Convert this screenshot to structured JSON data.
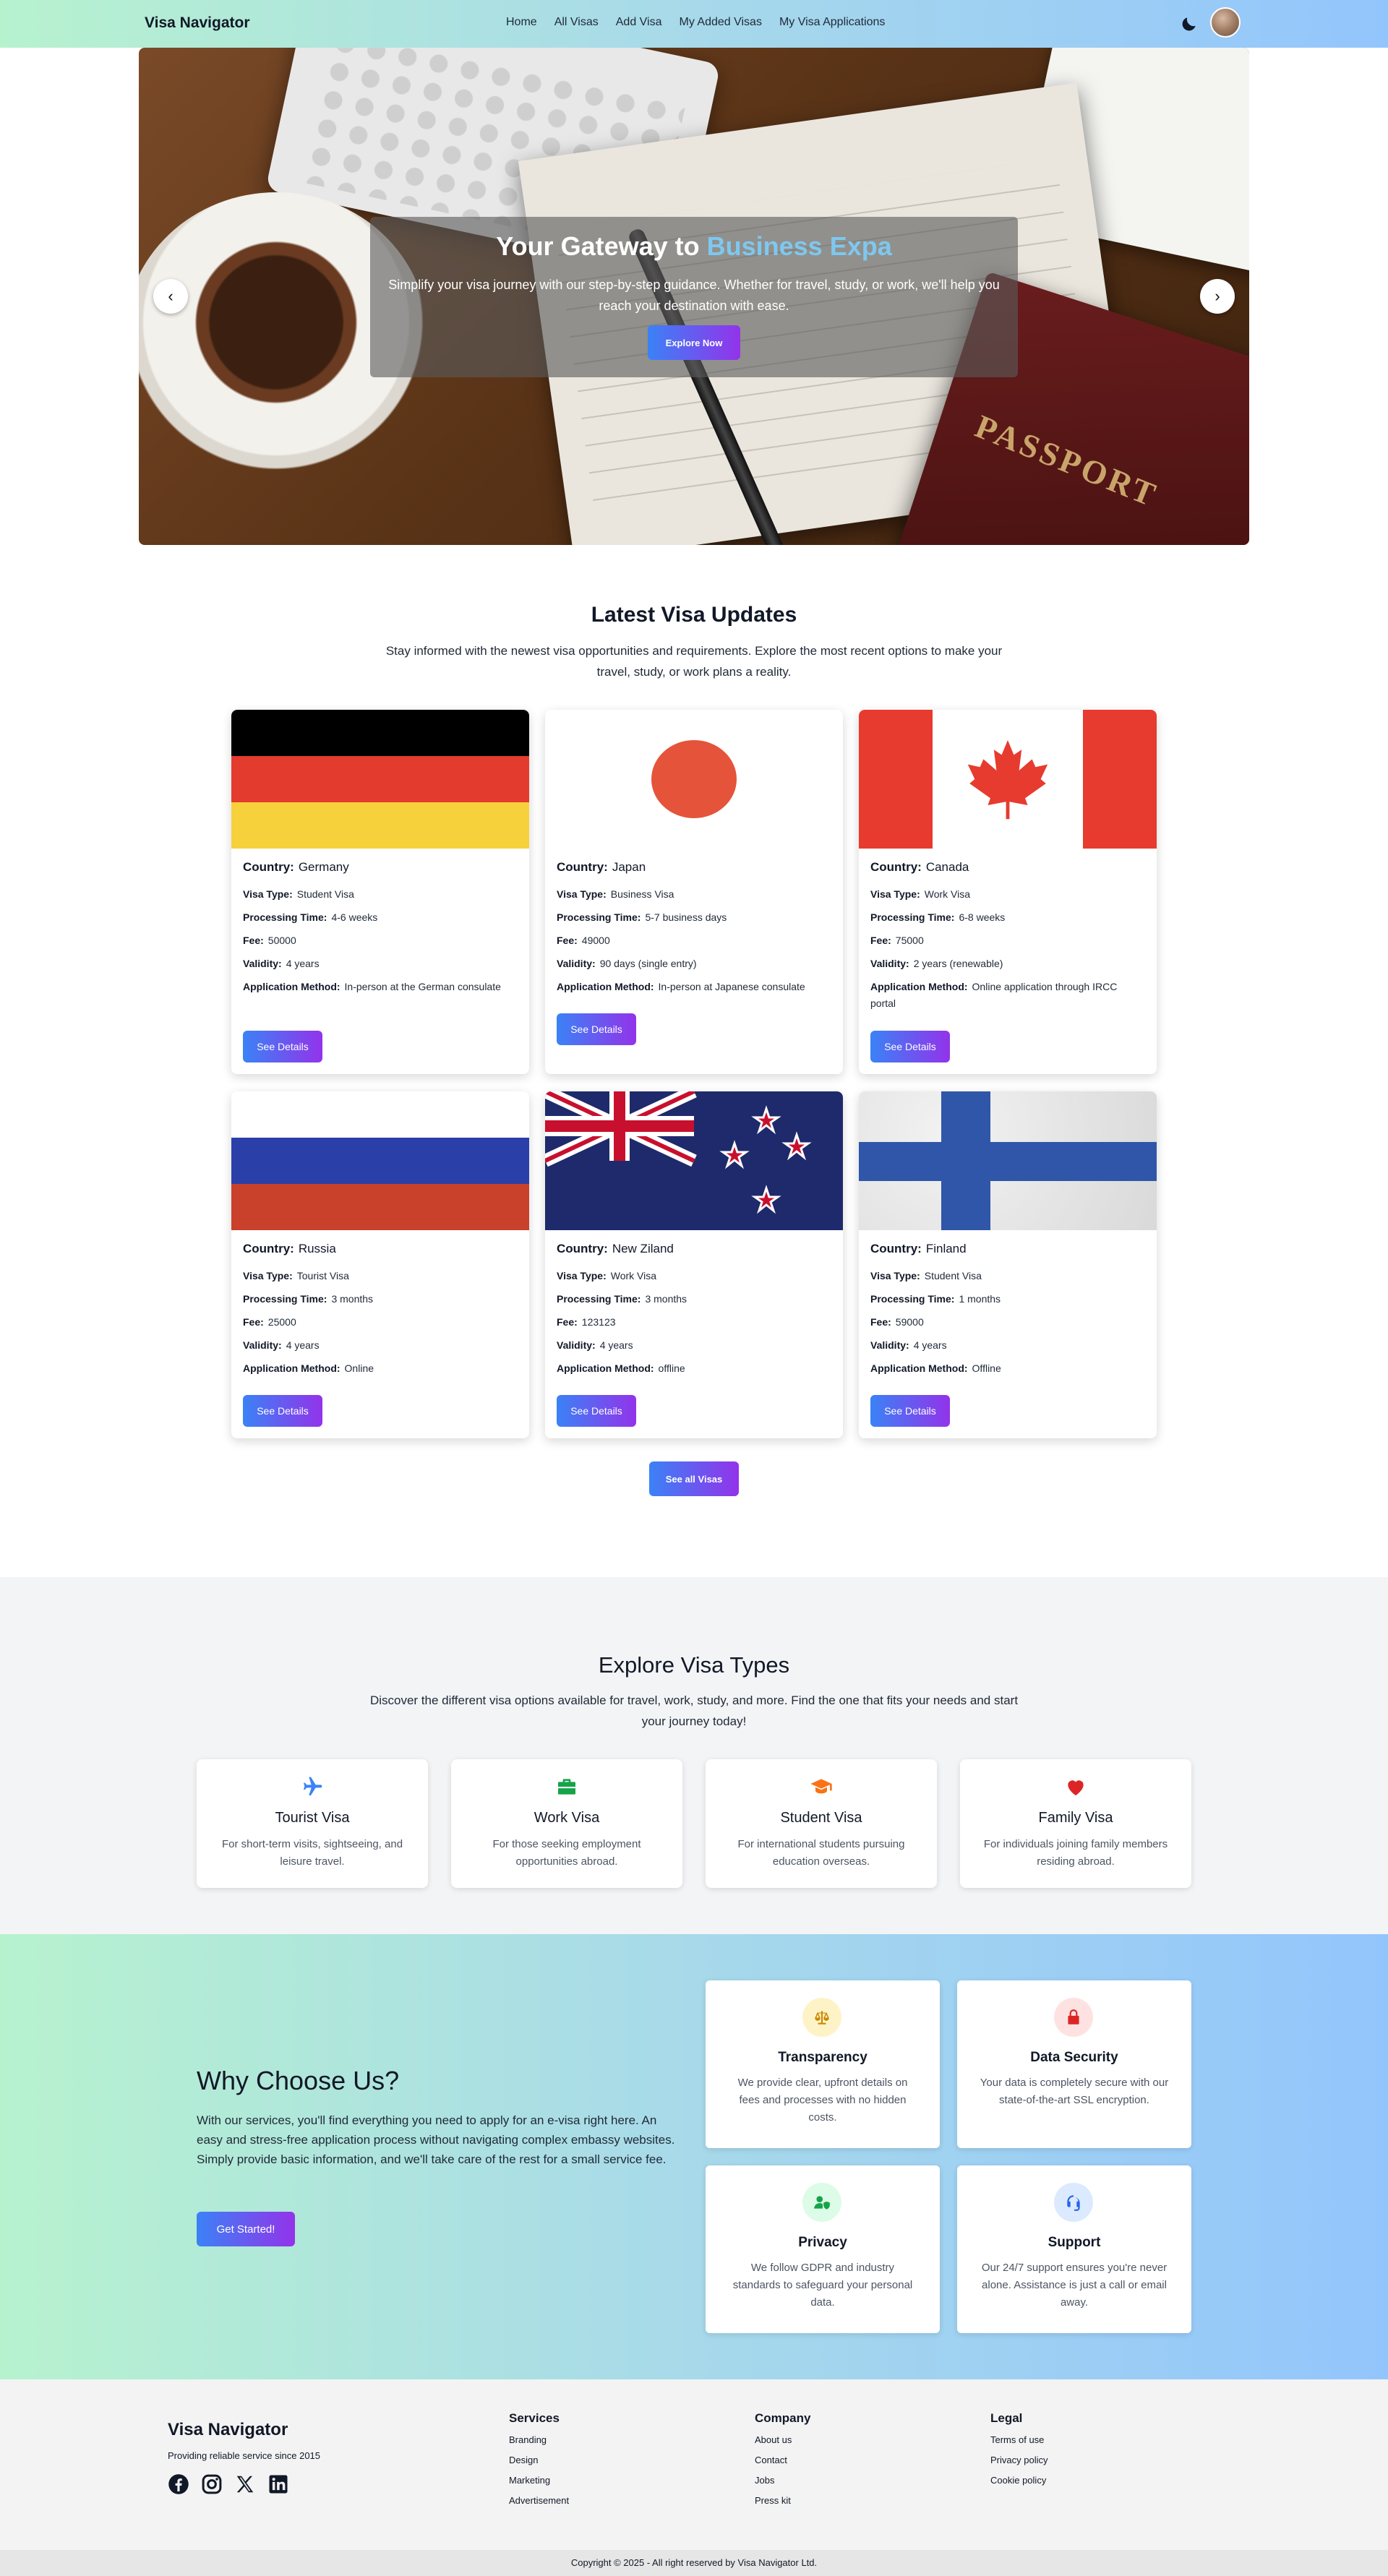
{
  "nav": {
    "brand": "Visa Navigator",
    "links": [
      "Home",
      "All Visas",
      "Add Visa",
      "My Added Visas",
      "My Visa Applications"
    ]
  },
  "hero": {
    "title_main": "Your Gateway to ",
    "title_accent": "Business Expa",
    "subtitle": "Simplify your visa journey with our step-by-step guidance. Whether for travel, study, or work, we'll help you reach your destination with ease.",
    "button": "Explore Now",
    "prev": "‹",
    "next": "›",
    "image_text": "PASSPORT"
  },
  "latest": {
    "title": "Latest Visa Updates",
    "subtitle": "Stay informed with the newest visa opportunities and requirements. Explore the most recent options to make your travel, study, or work plans a reality.",
    "labels": {
      "country": "Country:",
      "type": "Visa Type:",
      "time": "Processing Time:",
      "fee": "Fee:",
      "validity": "Validity:",
      "method": "Application Method:"
    },
    "button": "See Details",
    "see_all": "See all Visas",
    "cards": [
      {
        "country": "Germany",
        "type": "Student Visa",
        "time": "4-6 weeks",
        "fee": "50000",
        "validity": "4 years",
        "method": "In-person at the German consulate"
      },
      {
        "country": "Japan",
        "type": "Business Visa",
        "time": "5-7 business days",
        "fee": "49000",
        "validity": "90 days (single entry)",
        "method": "In-person at Japanese consulate"
      },
      {
        "country": "Canada",
        "type": "Work Visa",
        "time": "6-8 weeks",
        "fee": "75000",
        "validity": "2 years (renewable)",
        "method": "Online application through IRCC portal"
      },
      {
        "country": "Russia",
        "type": "Tourist Visa",
        "time": "3 months",
        "fee": "25000",
        "validity": "4 years",
        "method": "Online"
      },
      {
        "country": "New Ziland",
        "type": "Work Visa",
        "time": "3 months",
        "fee": "123123",
        "validity": "4 years",
        "method": "offline"
      },
      {
        "country": "Finland",
        "type": "Student Visa",
        "time": "1 months",
        "fee": "59000",
        "validity": "4 years",
        "method": "Offline"
      }
    ]
  },
  "explore": {
    "title": "Explore Visa Types",
    "subtitle": "Discover the different visa options available for travel, work, study, and more. Find the one that fits your needs and start your journey today!",
    "types": [
      {
        "name": "Tourist Visa",
        "desc": "For short-term visits, sightseeing, and leisure travel.",
        "icon": "airplane-icon",
        "color": "#3b82f6"
      },
      {
        "name": "Work Visa",
        "desc": "For those seeking employment opportunities abroad.",
        "icon": "briefcase-icon",
        "color": "#16a34a"
      },
      {
        "name": "Student Visa",
        "desc": "For international students pursuing education overseas.",
        "icon": "graduation-cap-icon",
        "color": "#f97316"
      },
      {
        "name": "Family Visa",
        "desc": "For individuals joining family members residing abroad.",
        "icon": "heart-icon",
        "color": "#dc2626"
      }
    ]
  },
  "why": {
    "title": "Why Choose Us?",
    "text": "With our services, you'll find everything you need to apply for an e-visa right here. An easy and stress-free application process without navigating complex embassy websites. Simply provide basic information, and we'll take care of the rest for a small service fee.",
    "button": "Get Started!",
    "features": [
      {
        "name": "Transparency",
        "desc": "We provide clear, upfront details on fees and processes with no hidden costs.",
        "icon": "scale-icon"
      },
      {
        "name": "Data Security",
        "desc": "Your data is completely secure with our state-of-the-art SSL encryption.",
        "icon": "lock-icon"
      },
      {
        "name": "Privacy",
        "desc": "We follow GDPR and industry standards to safeguard your personal data.",
        "icon": "user-shield-icon"
      },
      {
        "name": "Support",
        "desc": "Our 24/7 support ensures you're never alone. Assistance is just a call or email away.",
        "icon": "headset-icon"
      }
    ]
  },
  "footer": {
    "brand": "Visa Navigator",
    "tagline": "Providing reliable service since 2015",
    "columns": [
      {
        "title": "Services",
        "links": [
          "Branding",
          "Design",
          "Marketing",
          "Advertisement"
        ]
      },
      {
        "title": "Company",
        "links": [
          "About us",
          "Contact",
          "Jobs",
          "Press kit"
        ]
      },
      {
        "title": "Legal",
        "links": [
          "Terms of use",
          "Privacy policy",
          "Cookie policy"
        ]
      }
    ],
    "copyright": "Copyright © 2025 - All right reserved by Visa Navigator Ltd."
  }
}
